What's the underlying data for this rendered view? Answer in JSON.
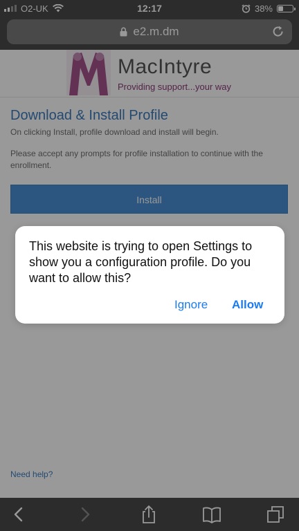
{
  "status_bar": {
    "carrier": "O2-UK",
    "time": "12:17",
    "battery_percent": "38%",
    "battery_level": 0.38
  },
  "address_bar": {
    "url": "e2.m.dm"
  },
  "logo": {
    "name": "MacIntyre",
    "tagline": "Providing support...your way"
  },
  "page": {
    "title": "Download & Install Profile",
    "paragraph_1": "On clicking Install, profile download and install will begin.",
    "paragraph_2": "Please accept any prompts for profile installation to continue with the enrollment.",
    "install_button": "Install",
    "need_help": "Need help?"
  },
  "alert": {
    "message": "This website is trying to open Settings to show you a configuration profile. Do you want to allow this?",
    "ignore_label": "Ignore",
    "allow_label": "Allow"
  },
  "toolbar": {
    "icons": [
      "back-icon",
      "forward-icon",
      "share-icon",
      "bookmarks-icon",
      "tabs-icon"
    ]
  },
  "colors": {
    "accent_blue": "#1a7cf0",
    "page_blue": "#3c7bbd",
    "brand_purple": "#8c3b78",
    "chrome_gray": "#4a4a4a"
  }
}
